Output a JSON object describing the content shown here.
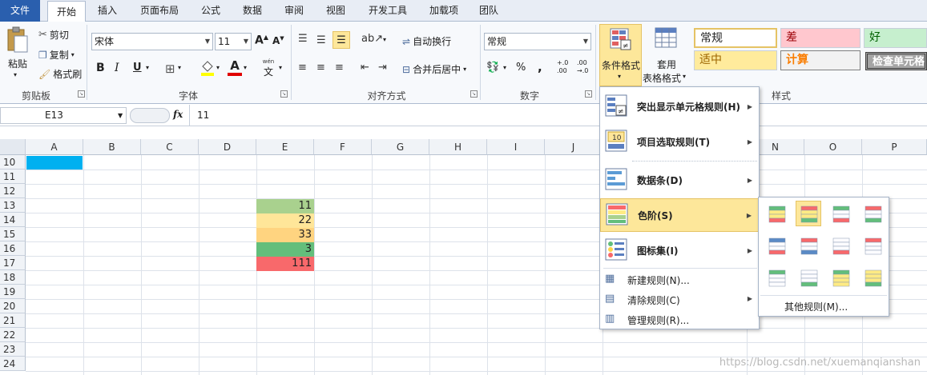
{
  "tabs": {
    "file": "文件",
    "home": "开始",
    "insert": "插入",
    "layout": "页面布局",
    "formula": "公式",
    "data": "数据",
    "review": "审阅",
    "view": "视图",
    "developer": "开发工具",
    "addins": "加载项",
    "team": "团队"
  },
  "clipboard": {
    "paste": "粘贴",
    "cut": "剪切",
    "copy": "复制",
    "painter": "格式刷",
    "group": "剪贴板"
  },
  "font": {
    "name": "宋体",
    "size": "11",
    "bold": "B",
    "italic": "I",
    "underline": "U",
    "wen": "wén",
    "wen_char": "文",
    "group": "字体"
  },
  "alignment": {
    "wrap": "自动换行",
    "merge": "合并后居中",
    "group": "对齐方式"
  },
  "number": {
    "format": "常规",
    "percent": "%",
    "comma": ",",
    "inc": "+.0 .00",
    "dec": ".00 →.0",
    "group": "数字"
  },
  "styles": {
    "cond_format": "条件格式",
    "table_format_1": "套用",
    "table_format_2": "表格格式",
    "normal": "常规",
    "bad": "差",
    "good": "好",
    "neutral": "适中",
    "calc": "计算",
    "check": "检查单元格",
    "group": "样式"
  },
  "formula_bar": {
    "cell_ref": "E13",
    "fx": "fx",
    "value": "11"
  },
  "columns": [
    "A",
    "B",
    "C",
    "D",
    "E",
    "F",
    "G",
    "H",
    "I",
    "J",
    "N",
    "O",
    "P"
  ],
  "rows": [
    "10",
    "11",
    "12",
    "13",
    "14",
    "15",
    "16",
    "17",
    "18",
    "19",
    "20",
    "21",
    "22",
    "23",
    "24"
  ],
  "cells": [
    {
      "value": "11",
      "color": "#a9d18e"
    },
    {
      "value": "22",
      "color": "#ffe699"
    },
    {
      "value": "33",
      "color": "#ffd480"
    },
    {
      "value": "3",
      "color": "#63be7b"
    },
    {
      "value": "111",
      "color": "#f8696b"
    }
  ],
  "selected_cell_color": "#00b0f0",
  "menu": {
    "highlight": "突出显示单元格规则(H)",
    "topbottom": "项目选取规则(T)",
    "databar": "数据条(D)",
    "colorscale": "色阶(S)",
    "iconset": "图标集(I)",
    "new_rule": "新建规则(N)...",
    "clear_rule": "清除规则(C)",
    "manage_rule": "管理规则(R)..."
  },
  "submenu": {
    "more_rules": "其他规则(M)..."
  },
  "watermark": "https://blog.csdn.net/xuemanqianshan"
}
